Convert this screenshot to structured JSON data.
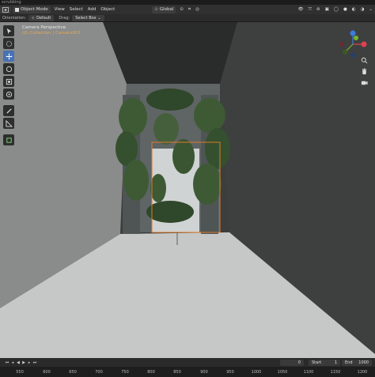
{
  "window": {
    "title": "scrubbing"
  },
  "header": {
    "mode": "Object Mode",
    "menus": [
      "View",
      "Select",
      "Add",
      "Object"
    ],
    "transform_orientation": "Global"
  },
  "tool_settings": {
    "orientation_label": "Orientation:",
    "orientation_value": "Default",
    "drag_label": "Drag:",
    "drag_value": "Select Box"
  },
  "viewport": {
    "camera_name": "Camera Perspective",
    "collection_path": "(0) Collection | Camera001"
  },
  "toolbar": {
    "tools": [
      "cursor-tool",
      "select-tool",
      "move-tool",
      "rotate-tool",
      "scale-tool",
      "transform-tool",
      "annotate-tool",
      "measure-tool",
      "add-cube-tool"
    ],
    "active_tool": "move-tool"
  },
  "timeline": {
    "current_frame": "0",
    "start_label": "Start",
    "start_value": "1",
    "end_label": "End",
    "end_value": "1000",
    "ruler": [
      "550",
      "600",
      "650",
      "700",
      "750",
      "800",
      "850",
      "900",
      "950",
      "1000",
      "1050",
      "1100",
      "1150",
      "1200"
    ]
  },
  "colors": {
    "active_tool": "#4772b3",
    "selection_outline": "#e07a2a",
    "gizmo_x": "#e0414e",
    "gizmo_y": "#77b52b",
    "gizmo_z": "#3b7ce0"
  }
}
